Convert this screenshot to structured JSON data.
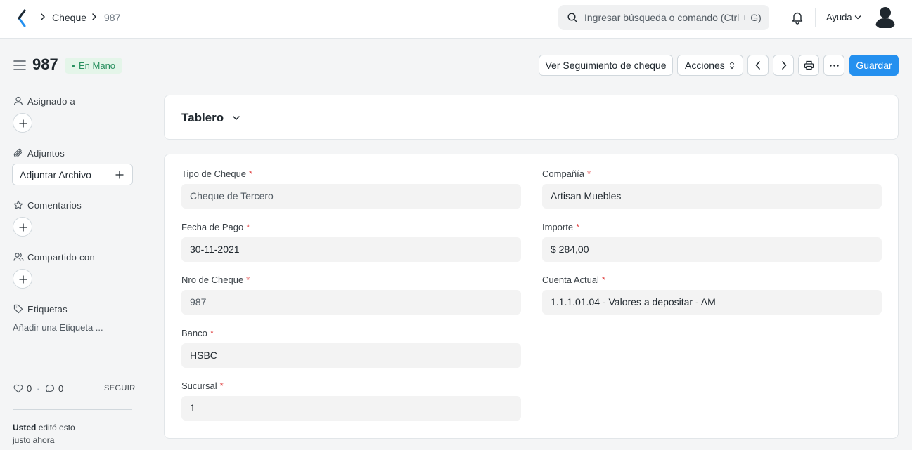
{
  "navbar": {
    "breadcrumbs": [
      "Cheque",
      "987"
    ],
    "search_placeholder": "Ingresar búsqueda o comando (Ctrl + G)",
    "help_label": "Ayuda"
  },
  "page": {
    "title": "987",
    "status": "En Mano",
    "status_color": "#278f5e"
  },
  "actions": {
    "tracking_label": "Ver Seguimiento de cheque",
    "actions_label": "Acciones",
    "save_label": "Guardar",
    "primary_color": "#2490ef"
  },
  "sidebar": {
    "assigned_label": "Asignado a",
    "attachments_label": "Adjuntos",
    "attach_button": "Adjuntar Archivo",
    "comments_label": "Comentarios",
    "shared_label": "Compartido con",
    "tags_label": "Etiquetas",
    "add_tag": "Añadir una Etiqueta ...",
    "likes_count": "0",
    "comments_count": "0",
    "follow_label": "SEGUIR",
    "edited_user": "Usted",
    "edited_text": "editó esto",
    "edited_time": "justo ahora"
  },
  "dashboard": {
    "label": "Tablero"
  },
  "form": {
    "left": [
      {
        "label": "Tipo de Cheque",
        "value": "Cheque de Tercero"
      },
      {
        "label": "Fecha de Pago",
        "value": "30-11-2021"
      },
      {
        "label": "Nro de Cheque",
        "value": "987"
      },
      {
        "label": "Banco",
        "value": "HSBC"
      },
      {
        "label": "Sucursal",
        "value": "1"
      }
    ],
    "right": [
      {
        "label": "Compañía",
        "value": "Artisan Muebles"
      },
      {
        "label": "Importe",
        "value": "$ 284,00"
      },
      {
        "label": "Cuenta Actual",
        "value": "1.1.1.01.04 - Valores a depositar - AM"
      }
    ],
    "required_mark": "*"
  }
}
